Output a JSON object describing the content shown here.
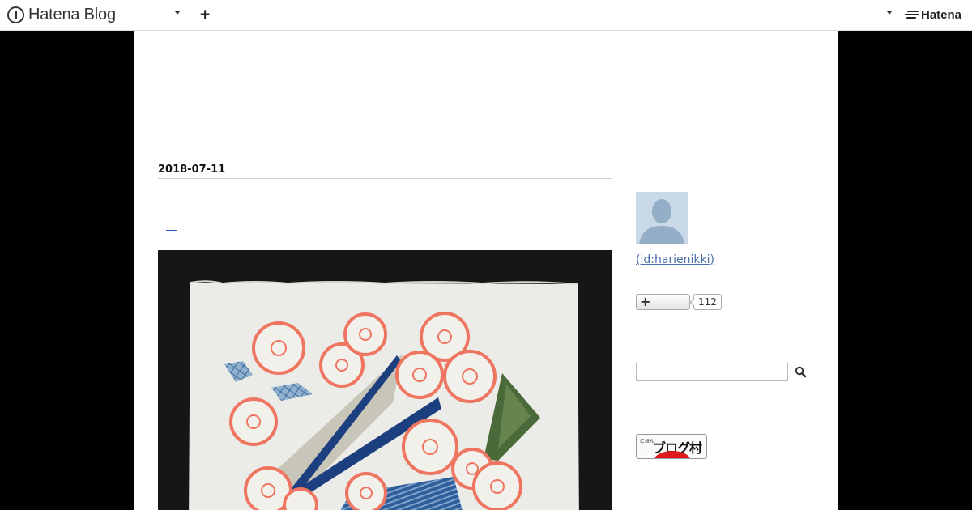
{
  "header": {
    "brand": "Hatena Blog",
    "add_label": "+",
    "hatena_label": "Hatena"
  },
  "entry": {
    "date": "2018-07-11"
  },
  "sidebar": {
    "profile_id": "(id:harienikki)",
    "readers_button": "+",
    "readers_count": "112",
    "search_placeholder": "",
    "blogmura_small": "にほん",
    "blogmura_label": "ブログ村"
  },
  "colors": {
    "link": "#4a6ea8",
    "background": "#000000",
    "content": "#ffffff"
  }
}
